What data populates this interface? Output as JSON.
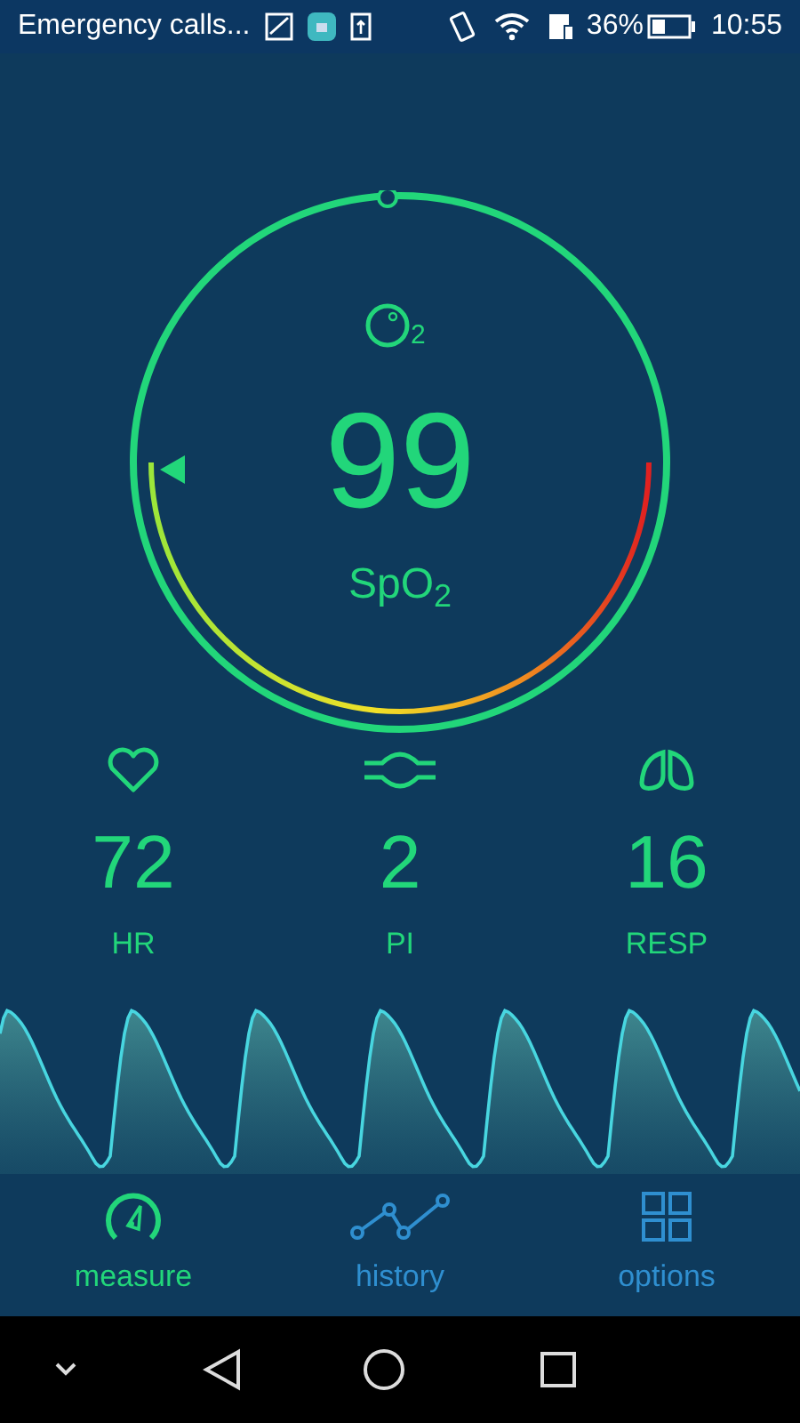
{
  "status_bar": {
    "carrier": "Emergency calls...",
    "battery": "36%",
    "time": "10:55"
  },
  "gauge": {
    "o2_subscript": "2",
    "value": "99",
    "label": "SpO$_{2}$"
  },
  "vitals": [
    {
      "kind": "heart",
      "value": "72",
      "label": "HR"
    },
    {
      "kind": "perfusion",
      "value": "2",
      "label": "PI"
    },
    {
      "kind": "lungs",
      "value": "16",
      "label": "RESP"
    }
  ],
  "tabs": [
    {
      "kind": "measure",
      "label": "measure",
      "selected": true
    },
    {
      "kind": "history",
      "label": "history",
      "selected": false
    },
    {
      "kind": "options",
      "label": "options",
      "selected": false
    }
  ]
}
